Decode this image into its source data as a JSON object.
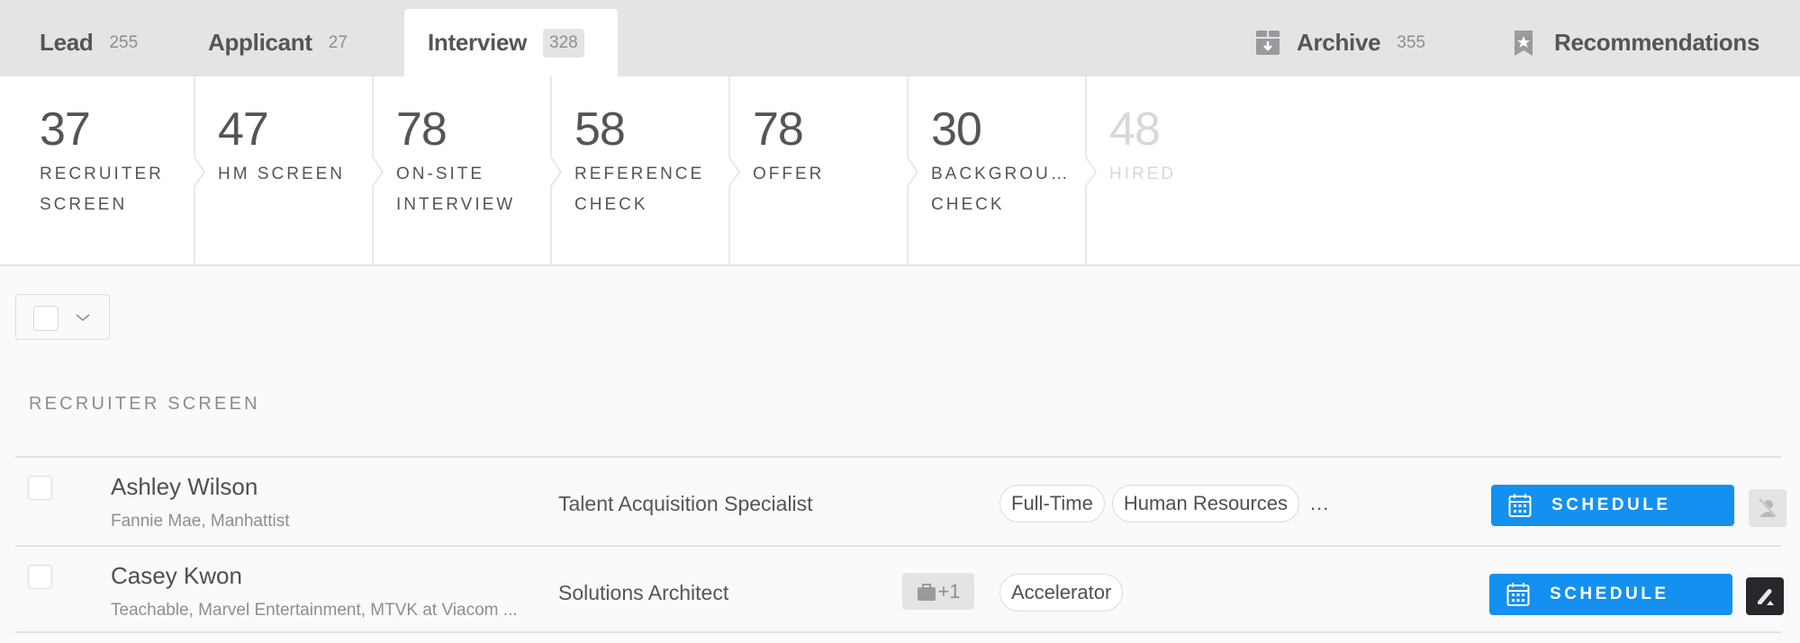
{
  "header": {
    "tabs": [
      {
        "label": "Lead",
        "count": "255",
        "active": false
      },
      {
        "label": "Applicant",
        "count": "27",
        "active": false
      },
      {
        "label": "Interview",
        "count": "328",
        "active": true
      }
    ],
    "archive": {
      "label": "Archive",
      "count": "355",
      "icon": "archive-box-icon"
    },
    "recommendations": {
      "label": "Recommendations",
      "icon": "bookmark-star-icon"
    }
  },
  "stages": [
    {
      "count": "37",
      "name": "RECRUITER SCREEN"
    },
    {
      "count": "47",
      "name": "HM SCREEN"
    },
    {
      "count": "78",
      "name": "ON-SITE INTERVIEW"
    },
    {
      "count": "58",
      "name": "REFERENCE CHECK"
    },
    {
      "count": "78",
      "name": "OFFER"
    },
    {
      "count": "30",
      "name": "BACKGROU… CHECK"
    },
    {
      "count": "48",
      "name": "HIRED",
      "muted": true
    }
  ],
  "section": {
    "title": "RECRUITER SCREEN"
  },
  "candidates": [
    {
      "name": "Ashley Wilson",
      "companies": "Fannie Mae, Manhattist",
      "job": "Talent Acquisition Specialist",
      "extra_jobs": null,
      "tags": [
        "Full-Time",
        "Human Resources"
      ],
      "more_tags": "...",
      "action_label": "SCHEDULE",
      "secondary_icon": "no-user-icon"
    },
    {
      "name": "Casey Kwon",
      "companies": "Teachable, Marvel Entertainment, MTVK at Viacom ...",
      "job": "Solutions Architect",
      "extra_jobs": "+1",
      "tags": [
        "Accelerator"
      ],
      "more_tags": null,
      "action_label": "SCHEDULE",
      "secondary_icon": "pencil-icon"
    }
  ],
  "colors": {
    "accent": "#1490f0",
    "header_bg": "#e3e4e6",
    "dark_button": "#27282d"
  }
}
